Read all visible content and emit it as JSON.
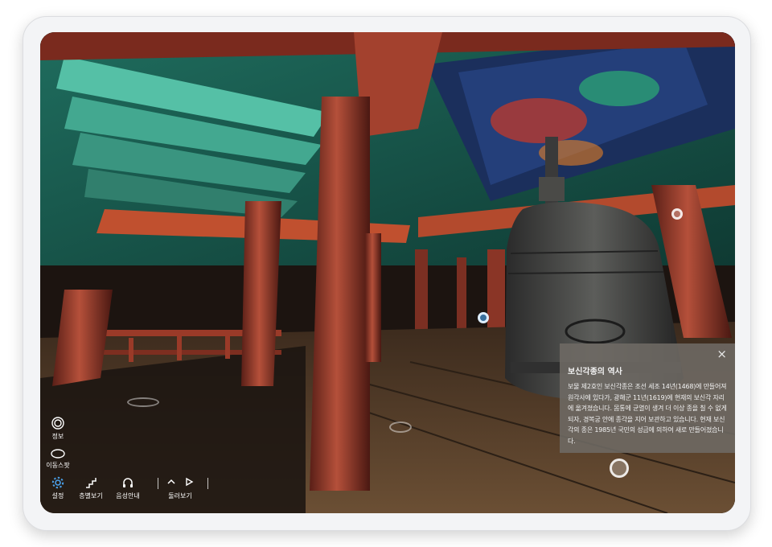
{
  "info_panel": {
    "close_icon": "×",
    "title": "보신각종의 역사",
    "body": "보물 제2호인 보신각종은 조선 세조 14년(1468)에 만들어져 원각사에 있다가, 광해군 11년(1619)에 현재의 보신각 자리에 옮겨졌습니다. 몸통에 균열이 생겨 더 이상 종을 칠 수 없게 되자, 경복궁 안에 종각을 지어 보관하고 있습니다. 현재 보신각의 종은 1985년 국민의 성금에 의하여 새로 만들어졌습니다."
  },
  "side_controls": {
    "info_label": "정보",
    "info_icon": "target-circle-icon",
    "move_label": "이동스팟",
    "move_icon": "ellipse-ring-icon"
  },
  "bottom_bar": {
    "settings_label": "설정",
    "settings_icon": "gear-icon",
    "floor_label": "층별보기",
    "floor_icon": "stairs-icon",
    "audio_label": "음성안내",
    "audio_icon": "headphones-icon",
    "tour_label": "둘러보기",
    "tour_icons": [
      "chevron-up-icon",
      "play-icon"
    ]
  },
  "colors": {
    "accent_blue": "#4a9fe8",
    "panel_bg": "#6e6a64",
    "pillar_red": "#9c3b2a",
    "dancheong_green": "#3fa58e"
  }
}
